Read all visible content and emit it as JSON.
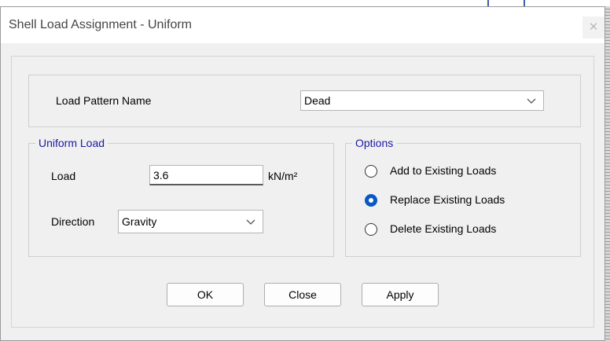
{
  "dialog": {
    "title": "Shell Load Assignment - Uniform",
    "close_glyph": "✕"
  },
  "load_pattern": {
    "label": "Load Pattern Name",
    "selected": "Dead"
  },
  "uniform_load": {
    "legend": "Uniform Load",
    "load_label": "Load",
    "load_value": "3.6",
    "load_unit": "kN/m²",
    "direction_label": "Direction",
    "direction_selected": "Gravity"
  },
  "options": {
    "legend": "Options",
    "items": [
      {
        "label": "Add to Existing Loads",
        "checked": false
      },
      {
        "label": "Replace Existing Loads",
        "checked": true
      },
      {
        "label": "Delete Existing Loads",
        "checked": false
      }
    ]
  },
  "buttons": {
    "ok": "OK",
    "close": "Close",
    "apply": "Apply"
  },
  "colors": {
    "group_legend": "#1a1aa6",
    "radio_selected": "#0a58c2"
  },
  "icons": {
    "dropdown": "chevron-down-icon",
    "window_close": "close-icon"
  }
}
